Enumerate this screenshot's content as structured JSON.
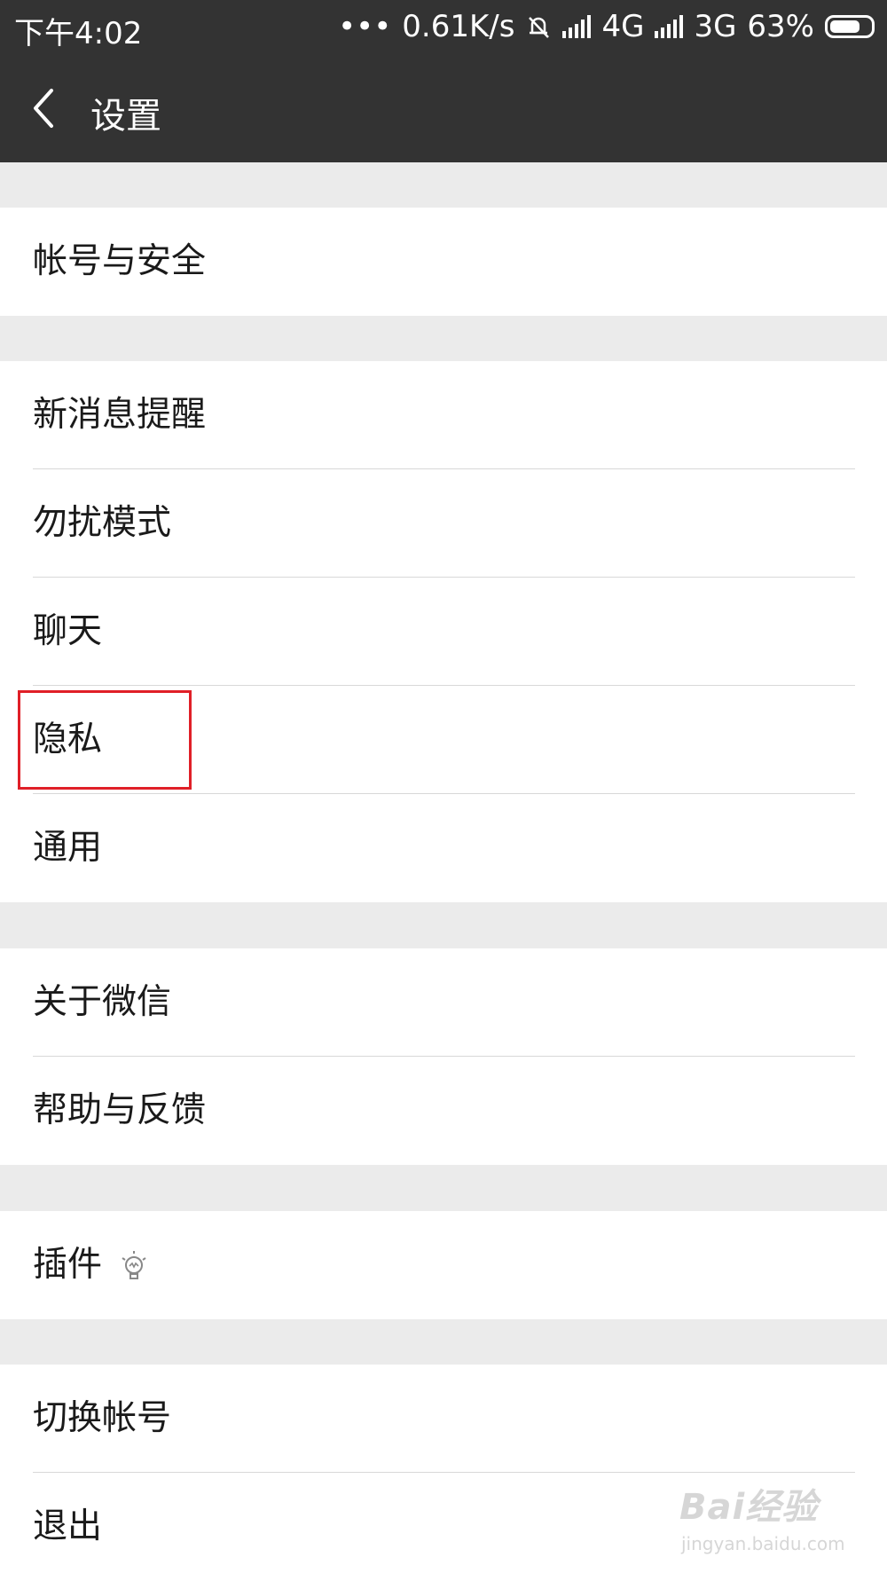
{
  "status_bar": {
    "time": "下午4:02",
    "more": "•••",
    "speed": "0.61K/s",
    "net1": "4G",
    "net2": "3G",
    "battery": "63%"
  },
  "nav": {
    "title": "设置"
  },
  "groups": [
    {
      "items": [
        "帐号与安全"
      ]
    },
    {
      "items": [
        "新消息提醒",
        "勿扰模式",
        "聊天",
        "隐私",
        "通用"
      ]
    },
    {
      "items": [
        "关于微信",
        "帮助与反馈"
      ]
    },
    {
      "items": [
        "插件"
      ]
    },
    {
      "items": [
        "切换帐号",
        "退出"
      ]
    }
  ],
  "highlight": {
    "color": "#e01f27",
    "target": "隐私"
  },
  "watermark": {
    "brand": "Bai经验",
    "url": "jingyan.baidu.com"
  }
}
